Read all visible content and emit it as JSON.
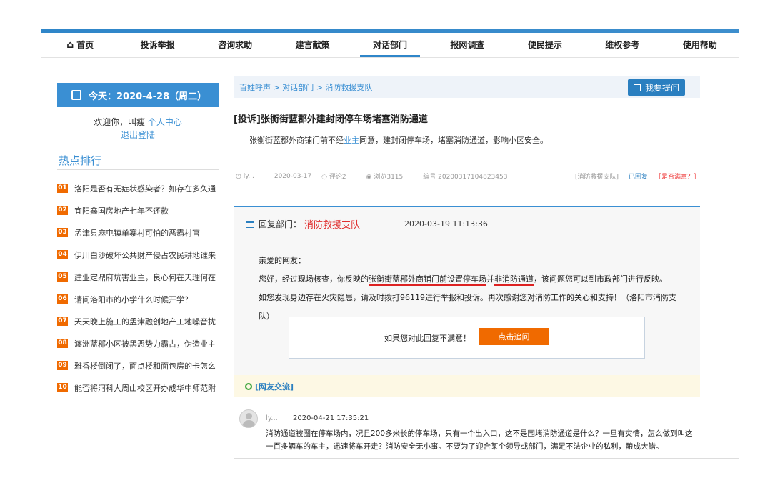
{
  "nav": {
    "items": [
      "首页",
      "投诉举报",
      "咨询求助",
      "建言献策",
      "对话部门",
      "报网调查",
      "便民提示",
      "维权参考",
      "使用帮助"
    ],
    "active_index": 4
  },
  "sidebar": {
    "today": "今天：2020-4-28（周二）",
    "welcome_text": "欢迎你，叫瘦",
    "personal_center": "个人中心",
    "logout": "退出登陆",
    "hot_title": "热点排行",
    "hot_items": [
      {
        "num": "01",
        "text": "洛阳是否有无症状感染者？如存在多久通"
      },
      {
        "num": "02",
        "text": "宜阳鑫国房地产七年不还款"
      },
      {
        "num": "03",
        "text": "孟津县麻屯镇单寨村可怕的恶霸村官"
      },
      {
        "num": "04",
        "text": "伊川白沙破坏公共财产侵占农民耕地谁来"
      },
      {
        "num": "05",
        "text": "建业定鼎府坑害业主，良心何在天理何在"
      },
      {
        "num": "06",
        "text": "请问洛阳市的小学什么时候开学？"
      },
      {
        "num": "07",
        "text": "天天晚上施工的孟津融创地产工地噪音扰"
      },
      {
        "num": "08",
        "text": "瀍洲蓝郡小区被黑恶势力霸占，伪造业主"
      },
      {
        "num": "09",
        "text": "雅香楼倒闭了，面点楼和面包房的卡怎么"
      },
      {
        "num": "10",
        "text": "能否将河科大周山校区开办成华中师范附"
      }
    ]
  },
  "breadcrumb": "百姓呼声 > 对话部门 > 消防救援支队",
  "ask_button": "我要提问",
  "post": {
    "title": "[投诉]张衡街蓝郡外建封闭停车场堵塞消防通道",
    "desc_before": "张衡街蓝郡外商铺门前不经",
    "desc_link": "业主",
    "desc_after": "同意，建封闭停车场，堵塞消防通道，影响小区安全。",
    "author": "ly...",
    "date": "2020-03-17",
    "comments": "评论2",
    "views": "浏览3115",
    "number": "编号 20200317104823453",
    "dept_tag": "[消防救援支队]",
    "replied": "已回复",
    "satisfied": "［是否满意？］"
  },
  "reply": {
    "label": "回复部门：",
    "dept": "消防救援支队",
    "time": "2020-03-19 11:13:36",
    "greeting": "亲爱的网友：",
    "p1_a": "您好，经过现场核查，你反映的",
    "p1_u1": "张衡街蓝郡外商铺门前设置停车场",
    "p1_b": "并",
    "p1_u2": "非消防通道",
    "p1_c": "，该问题您可以到市政部门进行反映。",
    "p2": "如您发现身边存在火灾隐患，请及时拨打96119进行举报和投诉。再次感谢您对消防工作的关心和支持！（洛阳市消防支队）",
    "dissatisfied": "如果您对此回复不满意！",
    "follow_up": "点击追问"
  },
  "exchange_label": "[网友交流]",
  "comment": {
    "user": "ly...",
    "time": "2020-04-21 17:35:21",
    "text": "消防通道被圈在停车场内，况且200多米长的停车场，只有一个出入口，这不是围堵消防通道是什么？一旦有灾情，怎么做到叫这一百多辆车的车主，迅速将车开走？消防安全无小事。不要为了迎合某个领导或部门，满足不法企业的私利，酿成大错。"
  }
}
